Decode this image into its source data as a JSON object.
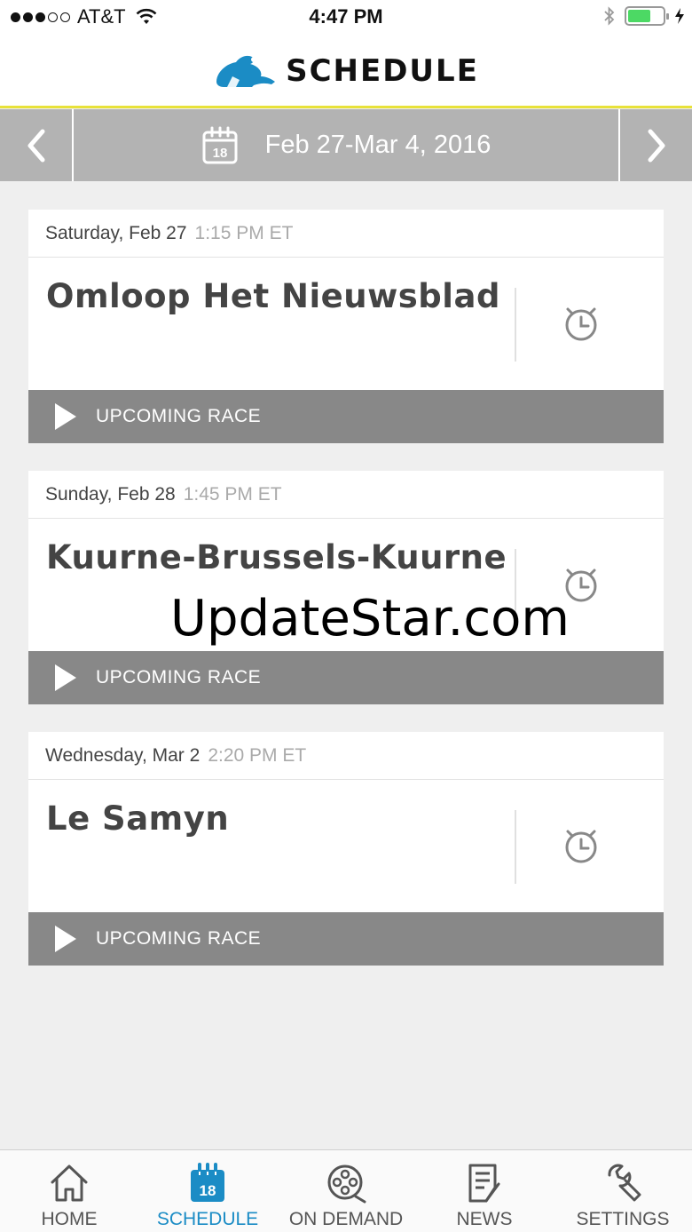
{
  "status_bar": {
    "carrier": "AT&T",
    "time": "4:47 PM",
    "battery_level": 0.65
  },
  "header": {
    "title": "SCHEDULE",
    "logo_icon": "rider-logo-icon",
    "brand_color": "#1b8cc5",
    "accent_line_color": "#e8e23a"
  },
  "week_nav": {
    "range": "Feb 27-Mar 4, 2016",
    "calendar_day": "18",
    "prev_icon": "chevron-left-icon",
    "next_icon": "chevron-right-icon"
  },
  "races": [
    {
      "date": "Saturday, Feb 27",
      "time": "1:15 PM ET",
      "name": "Omloop Het Nieuwsblad",
      "status": "UPCOMING RACE"
    },
    {
      "date": "Sunday, Feb 28",
      "time": "1:45 PM ET",
      "name": "Kuurne-Brussels-Kuurne",
      "status": "UPCOMING RACE"
    },
    {
      "date": "Wednesday, Mar 2",
      "time": "2:20 PM ET",
      "name": "Le Samyn",
      "status": "UPCOMING RACE"
    }
  ],
  "watermark": "UpdateStar.com",
  "tabs": [
    {
      "label": "HOME",
      "icon": "home-icon",
      "active": false
    },
    {
      "label": "SCHEDULE",
      "icon": "calendar-icon",
      "active": true
    },
    {
      "label": "ON DEMAND",
      "icon": "film-reel-icon",
      "active": false
    },
    {
      "label": "NEWS",
      "icon": "news-icon",
      "active": false
    },
    {
      "label": "SETTINGS",
      "icon": "wrench-icon",
      "active": false
    }
  ]
}
